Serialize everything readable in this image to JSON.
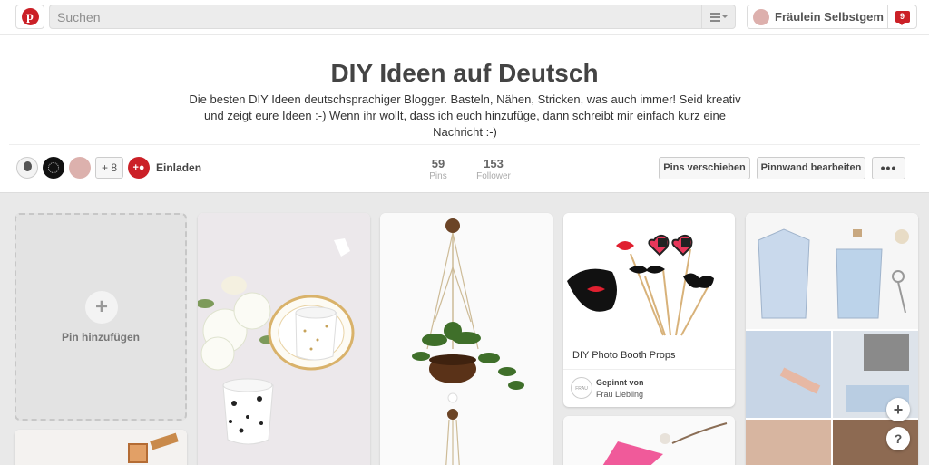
{
  "topbar": {
    "logo_icon": "pinterest-logo",
    "search_placeholder": "Suchen",
    "user_name": "Fräulein Selbstgemacht",
    "notification_count": "9"
  },
  "board": {
    "title": "DIY Ideen auf Deutsch",
    "description": "Die besten DIY Ideen deutschsprachiger Blogger. Basteln, Nähen, Stricken, was auch immer! Seid kreativ und zeigt eure Ideen :-) Wenn ihr wollt, dass ich euch hinzufüge, dann schreibt mir einfach kurz eine Nachricht :-)",
    "more_collaborators": "+ 8",
    "invite_label": "Einladen",
    "stats": [
      {
        "value": "59",
        "label": "Pins"
      },
      {
        "value": "153",
        "label": "Follower"
      }
    ],
    "buttons": {
      "move_pins": "Pins verschieben",
      "edit_board": "Pinnwand bearbeiten",
      "more": "•••"
    }
  },
  "grid": {
    "add_pin_label": "Pin hinzufügen",
    "add_pin_symbol": "+",
    "pins": [
      {
        "title": "DIY Photo Booth Props",
        "pinned_by_label": "Gepinnt von",
        "pinner": "Frau Liebling",
        "pinner_logo_text": "FRAU LIEBLING"
      }
    ],
    "floating": {
      "plus": "+",
      "help": "?"
    }
  },
  "colors": {
    "brand_red": "#cb2027",
    "background": "#e9e9e9"
  }
}
